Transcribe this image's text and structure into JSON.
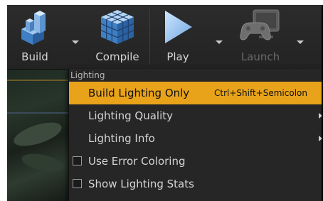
{
  "toolbar": {
    "buttons": [
      {
        "label": "Build",
        "icon": "build-blocks-icon",
        "enabled": true
      },
      {
        "label": "Compile",
        "icon": "compile-cube-icon",
        "enabled": true
      },
      {
        "label": "Play",
        "icon": "play-triangle-icon",
        "enabled": true
      },
      {
        "label": "Launch",
        "icon": "launch-monitor-icon",
        "enabled": false
      }
    ]
  },
  "menu": {
    "header": "Lighting",
    "items": [
      {
        "label": "Build Lighting Only",
        "shortcut": "Ctrl+Shift+Semicolon",
        "highlighted": true
      },
      {
        "label": "Lighting Quality",
        "submenu": true
      },
      {
        "label": "Lighting Info",
        "submenu": true
      },
      {
        "label": "Use Error Coloring",
        "checkbox": true,
        "checked": false
      },
      {
        "label": "Show Lighting Stats",
        "checkbox": true,
        "checked": false
      }
    ]
  },
  "colors": {
    "highlight": "#e8a31a",
    "toolbar_bg": "#2a2a2a",
    "menu_bg": "#262626",
    "text": "#d4d4d4"
  }
}
